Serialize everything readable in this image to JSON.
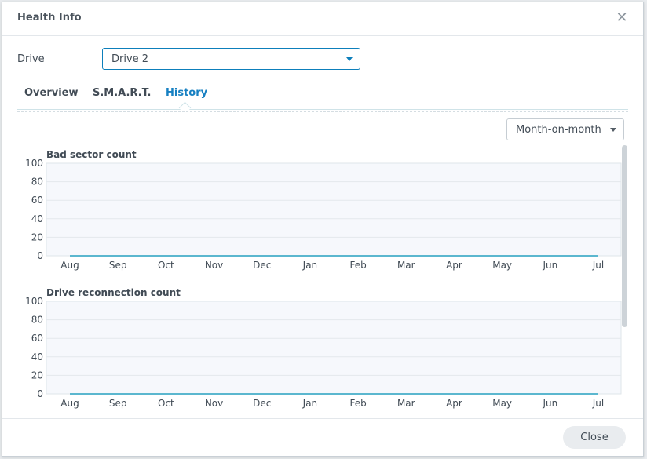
{
  "dialog": {
    "title": "Health Info",
    "close_icon": "close-icon"
  },
  "drive": {
    "label": "Drive",
    "selected": "Drive 2"
  },
  "tabs": [
    {
      "label": "Overview",
      "active": false
    },
    {
      "label": "S.M.A.R.T.",
      "active": false
    },
    {
      "label": "History",
      "active": true
    }
  ],
  "period": {
    "selected": "Month-on-month"
  },
  "colors": {
    "accent": "#1780c2",
    "line": "#5bb7cf",
    "plot_bg": "#f6f8fc"
  },
  "chart_data": [
    {
      "type": "line",
      "title": "Bad sector count",
      "categories": [
        "Aug",
        "Sep",
        "Oct",
        "Nov",
        "Dec",
        "Jan",
        "Feb",
        "Mar",
        "Apr",
        "May",
        "Jun",
        "Jul"
      ],
      "values": [
        0,
        0,
        0,
        0,
        0,
        0,
        0,
        0,
        0,
        0,
        0,
        0
      ],
      "yticks": [
        0,
        20,
        40,
        60,
        80,
        100
      ],
      "ylim": [
        0,
        100
      ],
      "grid": true
    },
    {
      "type": "line",
      "title": "Drive reconnection count",
      "categories": [
        "Aug",
        "Sep",
        "Oct",
        "Nov",
        "Dec",
        "Jan",
        "Feb",
        "Mar",
        "Apr",
        "May",
        "Jun",
        "Jul"
      ],
      "values": [
        0,
        0,
        0,
        0,
        0,
        0,
        0,
        0,
        0,
        0,
        0,
        0
      ],
      "yticks": [
        0,
        20,
        40,
        60,
        80,
        100
      ],
      "ylim": [
        0,
        100
      ],
      "grid": true
    }
  ],
  "footer": {
    "close_label": "Close"
  }
}
